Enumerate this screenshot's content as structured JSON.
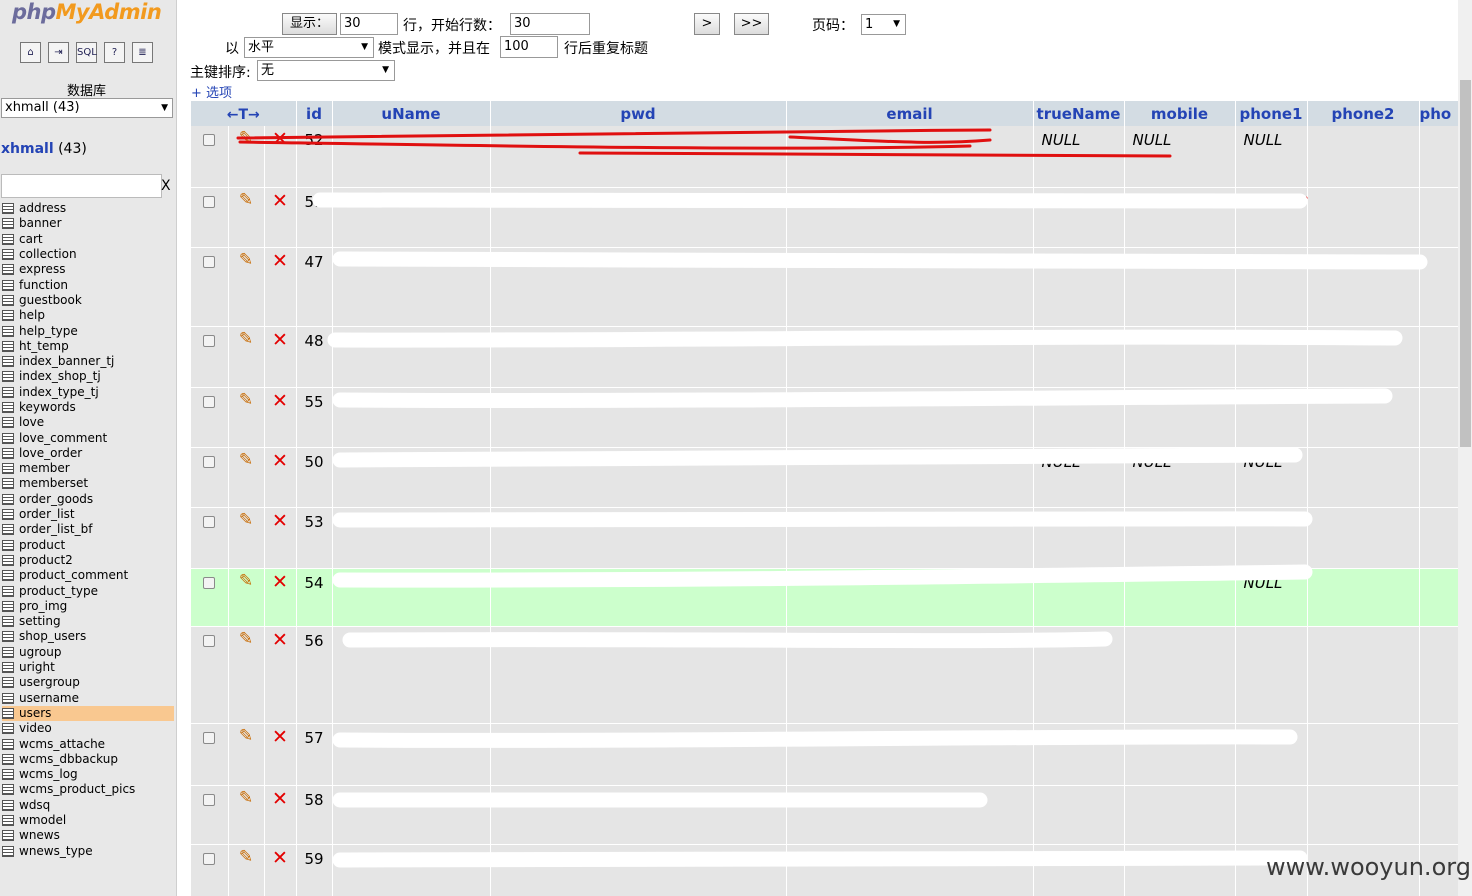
{
  "sidebar": {
    "logo_php": "php",
    "logo_myadmin": "MyAdmin",
    "nav_icons": [
      {
        "name": "home-icon",
        "glyph": "⌂"
      },
      {
        "name": "exit-icon",
        "glyph": "⇥"
      },
      {
        "name": "sql-icon",
        "glyph": "SQL"
      },
      {
        "name": "help-icon",
        "glyph": "?"
      },
      {
        "name": "docs-icon",
        "glyph": "≣"
      }
    ],
    "db_label": "数据库",
    "db_select_value": "xhmall (43)",
    "db_title_name": "xhmall",
    "db_title_count": "(43)",
    "filter_clear": "X",
    "tables": [
      "address",
      "banner",
      "cart",
      "collection",
      "express",
      "function",
      "guestbook",
      "help",
      "help_type",
      "ht_temp",
      "index_banner_tj",
      "index_shop_tj",
      "index_type_tj",
      "keywords",
      "love",
      "love_comment",
      "love_order",
      "member",
      "memberset",
      "order_goods",
      "order_list",
      "order_list_bf",
      "product",
      "product2",
      "product_comment",
      "product_type",
      "pro_img",
      "setting",
      "shop_users",
      "ugroup",
      "uright",
      "usergroup",
      "username",
      "users",
      "video",
      "wcms_attache",
      "wcms_dbbackup",
      "wcms_log",
      "wcms_product_pics",
      "wdsq",
      "wmodel",
      "wnews",
      "wnews_type"
    ],
    "active_table": "users"
  },
  "controls": {
    "show_button": "显示：",
    "rows_value": "30",
    "rows_label": "行，开始行数：",
    "start_value": "30",
    "next_button": ">",
    "last_button": ">>",
    "page_label": "页码：",
    "page_value": "1",
    "mode_prefix": "以",
    "mode_value": "水平",
    "mode_label": "模式显示，并且在",
    "repeat_value": "100",
    "repeat_label": "行后重复标题",
    "sort_label": "主键排序:",
    "sort_value": "无",
    "options_link": "+ 选项"
  },
  "grid": {
    "sort_arrows": "←T→",
    "columns": [
      "id",
      "uName",
      "pwd",
      "email",
      "trueName",
      "mobile",
      "phone1",
      "phone2",
      "pho"
    ],
    "rows": [
      {
        "id": "52",
        "truename": "NULL",
        "mobile": "NULL",
        "phone1": "NULL",
        "phone2": ""
      },
      {
        "id": "51",
        "truename": "",
        "mobile": "NULL",
        "phone1": "NULL",
        "phone2": ""
      },
      {
        "id": "47",
        "truename": "",
        "mobile": "",
        "phone1": "",
        "phone2": ""
      },
      {
        "id": "48",
        "truename": "",
        "mobile": "",
        "phone1": "",
        "phone2": ""
      },
      {
        "id": "55",
        "truename": "",
        "mobile": "",
        "phone1": "",
        "phone2": ""
      },
      {
        "id": "50",
        "truename": "NULL",
        "mobile": "NULL",
        "phone1": "NULL",
        "phone2": ""
      },
      {
        "id": "53",
        "truename": "",
        "mobile": "",
        "phone1": "",
        "phone2": ""
      },
      {
        "id": "54",
        "truename": "",
        "mobile": "",
        "phone1": "NULL",
        "phone2": ""
      },
      {
        "id": "56",
        "truename": "",
        "mobile": "",
        "phone1": "",
        "phone2": ""
      },
      {
        "id": "57",
        "truename": "",
        "mobile": "",
        "phone1": "NULL",
        "phone2": ""
      },
      {
        "id": "58",
        "truename": "",
        "mobile": "",
        "phone1": "",
        "phone2": ""
      },
      {
        "id": "59",
        "truename": "NULL",
        "mobile": "NULL",
        "phone1": "",
        "phone2": ""
      }
    ],
    "highlighted_row_index": 7
  },
  "watermark": "www.wooyun.org",
  "colors": {
    "header_bg": "#d3dce3",
    "row_bg": "#e5e5e5",
    "highlight_bg": "#ccffcc",
    "active_table_bg": "#f9c890",
    "link": "#2444b5"
  }
}
